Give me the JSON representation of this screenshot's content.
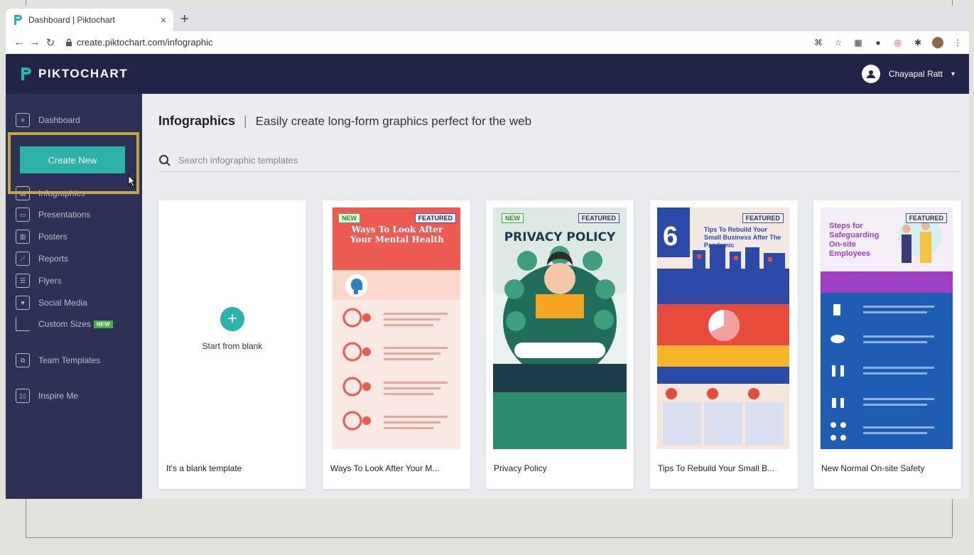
{
  "browser": {
    "tab_title": "Dashboard | Piktochart",
    "tab_close": "×",
    "new_tab": "+",
    "url": "create.piktochart.com/infographic"
  },
  "header": {
    "brand": "PIKTOCHART",
    "user_name": "Chayapal Ratt"
  },
  "sidebar": {
    "dashboard": "Dashboard",
    "create_new": "Create New",
    "items": [
      {
        "label": "Infographics",
        "icon": "infographic-icon"
      },
      {
        "label": "Presentations",
        "icon": "presentation-icon"
      },
      {
        "label": "Posters",
        "icon": "poster-icon"
      },
      {
        "label": "Reports",
        "icon": "report-icon"
      },
      {
        "label": "Flyers",
        "icon": "flyer-icon"
      },
      {
        "label": "Social Media",
        "icon": "social-media-icon"
      },
      {
        "label": "Custom Sizes",
        "icon": "custom-size-icon"
      }
    ],
    "new_badge": "NEW",
    "team_templates": "Team Templates",
    "inspire_me": "Inspire Me"
  },
  "main": {
    "title": "Infographics",
    "separator": "|",
    "subtitle": "Easily create long-form graphics perfect for the web",
    "search_placeholder": "Search infographic templates",
    "blank_card_text": "Start from blank",
    "badge_new": "NEW",
    "badge_featured": "FEATURED",
    "cards": [
      {
        "label": "It's a blank template"
      },
      {
        "label": "Ways To Look After Your M...",
        "thumb_title": "Ways To Look After Your Mental Health"
      },
      {
        "label": "Privacy Policy",
        "thumb_title": "PRIVACY POLICY"
      },
      {
        "label": "Tips To Rebuild Your Small B...",
        "thumb_title": "Tips To Rebuild Your Small Business After The Pandemic",
        "thumb_number": "6"
      },
      {
        "label": "New Normal On-site Safety",
        "thumb_title": "Steps for Safeguarding On-site Employees"
      }
    ]
  },
  "colors": {
    "header_bg": "#212447",
    "sidebar_bg": "#2e3156",
    "accent": "#2bb3a8",
    "highlight": "#c6a441"
  }
}
